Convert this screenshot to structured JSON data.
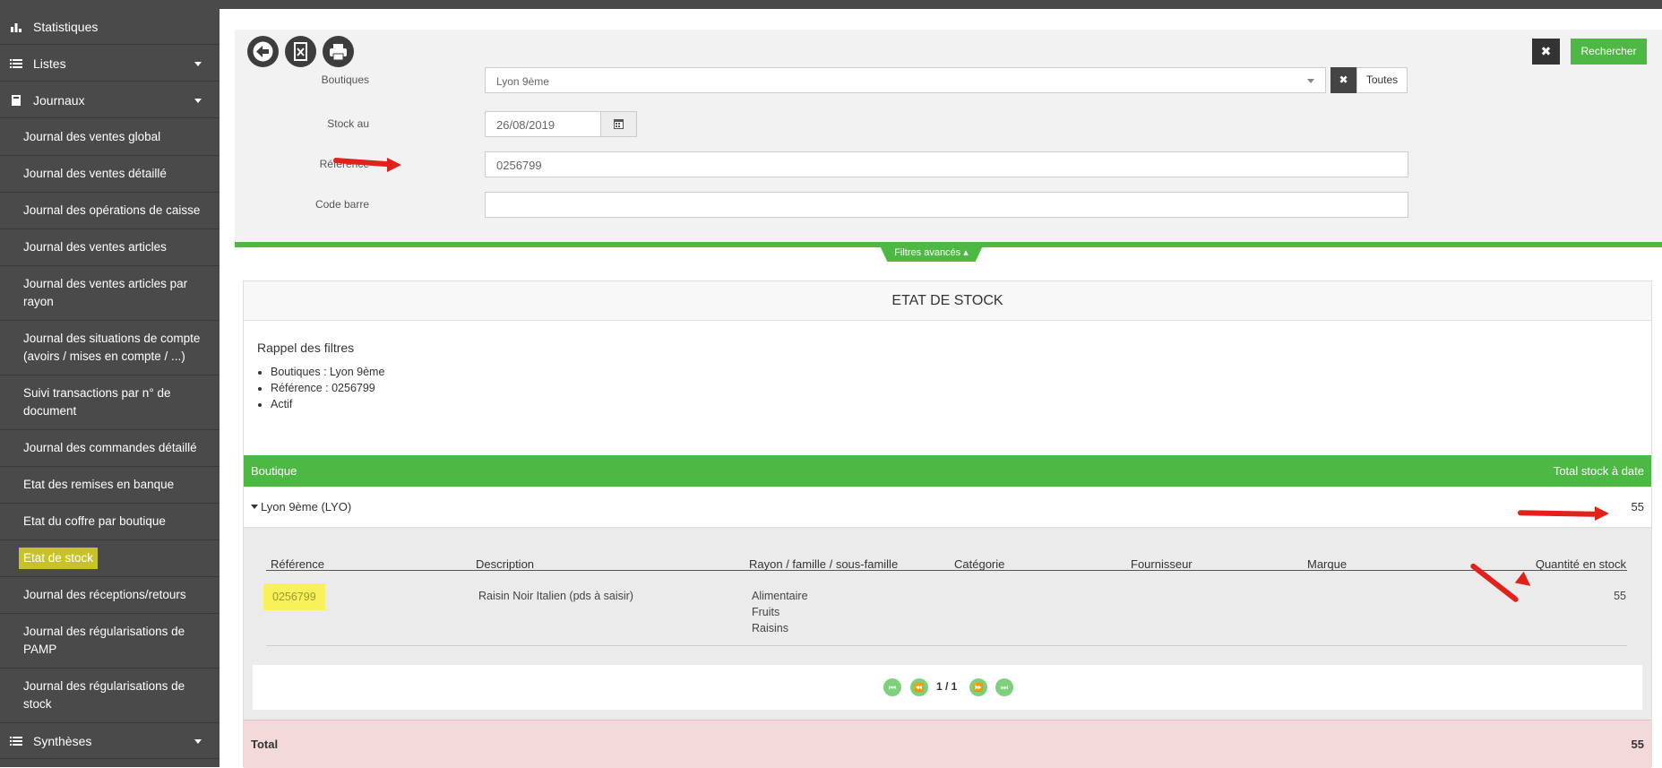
{
  "sidebar": {
    "sections": [
      {
        "label": "Statistiques",
        "icon": "bar-chart-icon"
      },
      {
        "label": "Listes",
        "icon": "list-icon"
      },
      {
        "label": "Journaux",
        "icon": "book-icon"
      },
      {
        "label": "Synthèses",
        "icon": "list-icon"
      }
    ],
    "items": [
      "Journal des ventes global",
      "Journal des ventes détaillé",
      "Journal des opérations de caisse",
      "Journal des ventes articles",
      "Journal des ventes articles par rayon",
      "Journal des situations de compte (avoirs / mises en compte / ...)",
      "Suivi transactions par n° de document",
      "Journal des commandes détaillé",
      "Etat des remises en banque",
      "Etat du coffre par boutique",
      "Etat de stock",
      "Journal des réceptions/retours",
      "Journal des régularisations de PAMP",
      "Journal des régularisations de stock"
    ],
    "active_item": "Etat de stock"
  },
  "toolbar": {
    "back_icon": "back-arrow-icon",
    "excel_icon": "excel-file-icon",
    "print_icon": "print-icon",
    "clear_label": "✖",
    "search_label": "Rechercher"
  },
  "filters": {
    "boutiques_label": "Boutiques",
    "boutiques_value": "Lyon 9ème",
    "boutiques_all": "Toutes",
    "stock_label": "Stock au",
    "stock_value": "26/08/2019",
    "reference_label": "Référence",
    "reference_value": "0256799",
    "codebarre_label": "Code barre",
    "codebarre_value": "",
    "advanced_label": "Filtres avancés"
  },
  "report": {
    "title": "ETAT DE STOCK",
    "recall_title": "Rappel des filtres",
    "recall_items": [
      "Boutiques : Lyon 9ème",
      "Référence : 0256799",
      "Actif"
    ],
    "group_header": {
      "left": "Boutique",
      "right": "Total stock à date"
    },
    "group_row": {
      "name": "Lyon 9ème (LYO)",
      "total": "55"
    },
    "columns": [
      "Référence",
      "Description",
      "Rayon / famille / sous-famille",
      "Catégorie",
      "Fournisseur",
      "Marque",
      "Quantité en stock"
    ],
    "rows": [
      {
        "reference": "0256799",
        "description": "Raisin Noir Italien (pds à saisir)",
        "rayon": "Alimentaire",
        "famille": "Fruits",
        "sous_famille": "Raisins",
        "categorie": "",
        "fournisseur": "",
        "marque": "",
        "quantite": "55"
      }
    ],
    "pager": {
      "text": "1 / 1"
    },
    "total": {
      "label": "Total",
      "value": "55"
    }
  },
  "colors": {
    "accent": "#4db843",
    "sidebar": "#4a4a4a",
    "highlight": "#f7f25a",
    "total_bg": "#f3d9d9",
    "arrow": "#e0221b"
  }
}
